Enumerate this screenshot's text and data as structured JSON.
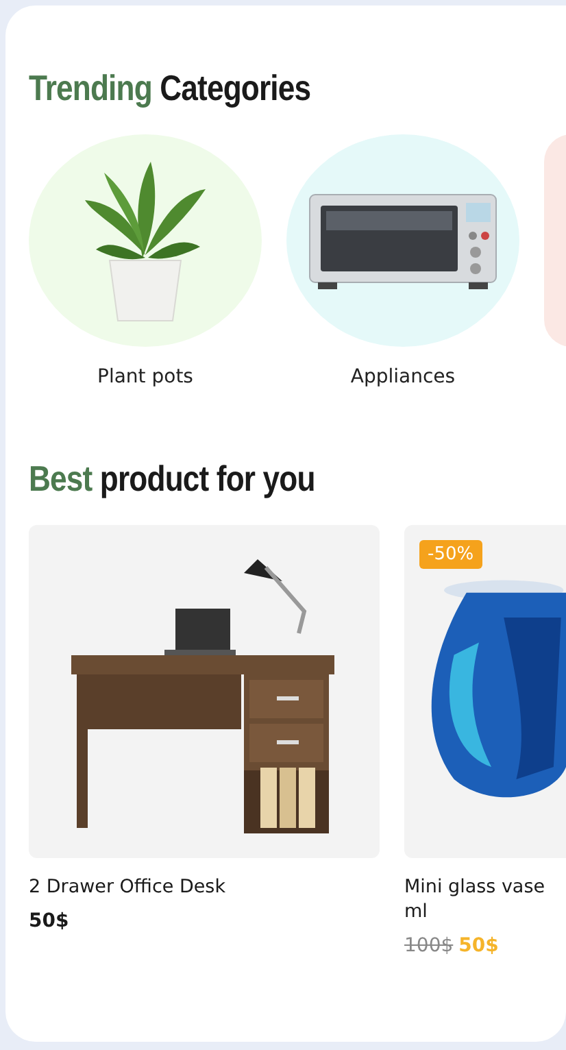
{
  "categories_section": {
    "title_accent": "Trending",
    "title_rest": "Categories",
    "categories": [
      {
        "kind": "plant",
        "label": "Plant pots",
        "color": "#effbe9"
      },
      {
        "kind": "oven",
        "label": "Appliances",
        "color": "#e5f9f9"
      },
      {
        "kind": "other",
        "color": "#fbe8e4"
      }
    ]
  },
  "products_section": {
    "title_accent": "Best",
    "title_rest": "product for you",
    "products": [
      {
        "kind": "desk",
        "name": "2 Drawer Office Desk",
        "price": "50$"
      },
      {
        "kind": "vase",
        "badge": "-50%",
        "name": "Mini glass vase ml",
        "old_price": "100$",
        "price": "50$"
      }
    ]
  }
}
